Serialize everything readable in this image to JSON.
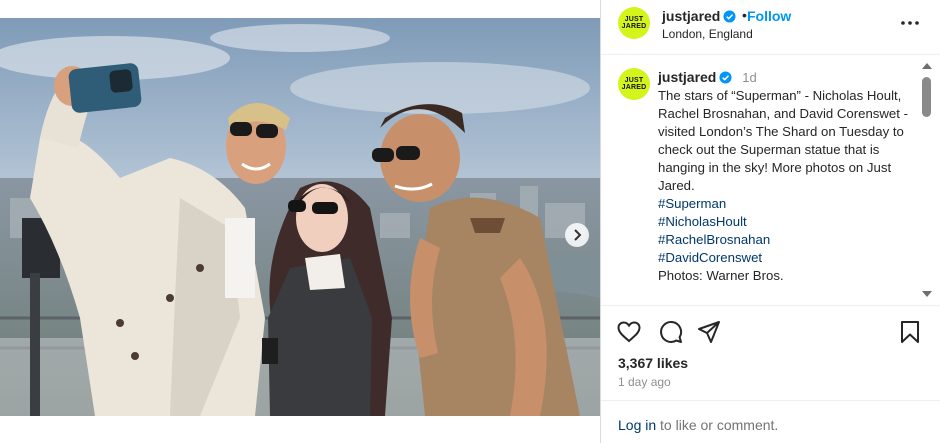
{
  "post": {
    "username": "justjared",
    "follow_label": "Follow",
    "separator": "•",
    "location": "London, England",
    "avatar_text": [
      "JUST",
      "JARED"
    ],
    "caption": {
      "username": "justjared",
      "time": "1d",
      "text": "The stars of “Superman” - Nicholas Hoult, Rachel Brosnahan, and David Corenswet - visited London’s The Shard on Tuesday to check out the Superman statue that is hanging in the sky! More photos on Just Jared.",
      "hashtags": [
        "#Superman",
        "#NicholasHoult",
        "#RachelBrosnahan",
        "#DavidCorenswet"
      ],
      "credit": "Photos: Warner Bros."
    },
    "likes": "3,367 likes",
    "time_ago": "1 day ago",
    "login_link": "Log in",
    "login_suffix": " to like or comment."
  },
  "carousel": {
    "slide_count": 4,
    "active_index": 0
  },
  "colors": {
    "accent": "#0095f6",
    "avatar_bg": "#d4f51c",
    "hashtag": "#00376b"
  },
  "icons": [
    "verified-badge-icon",
    "more-options-icon",
    "heart-icon",
    "comment-icon",
    "share-icon",
    "bookmark-icon",
    "chevron-right-icon"
  ]
}
